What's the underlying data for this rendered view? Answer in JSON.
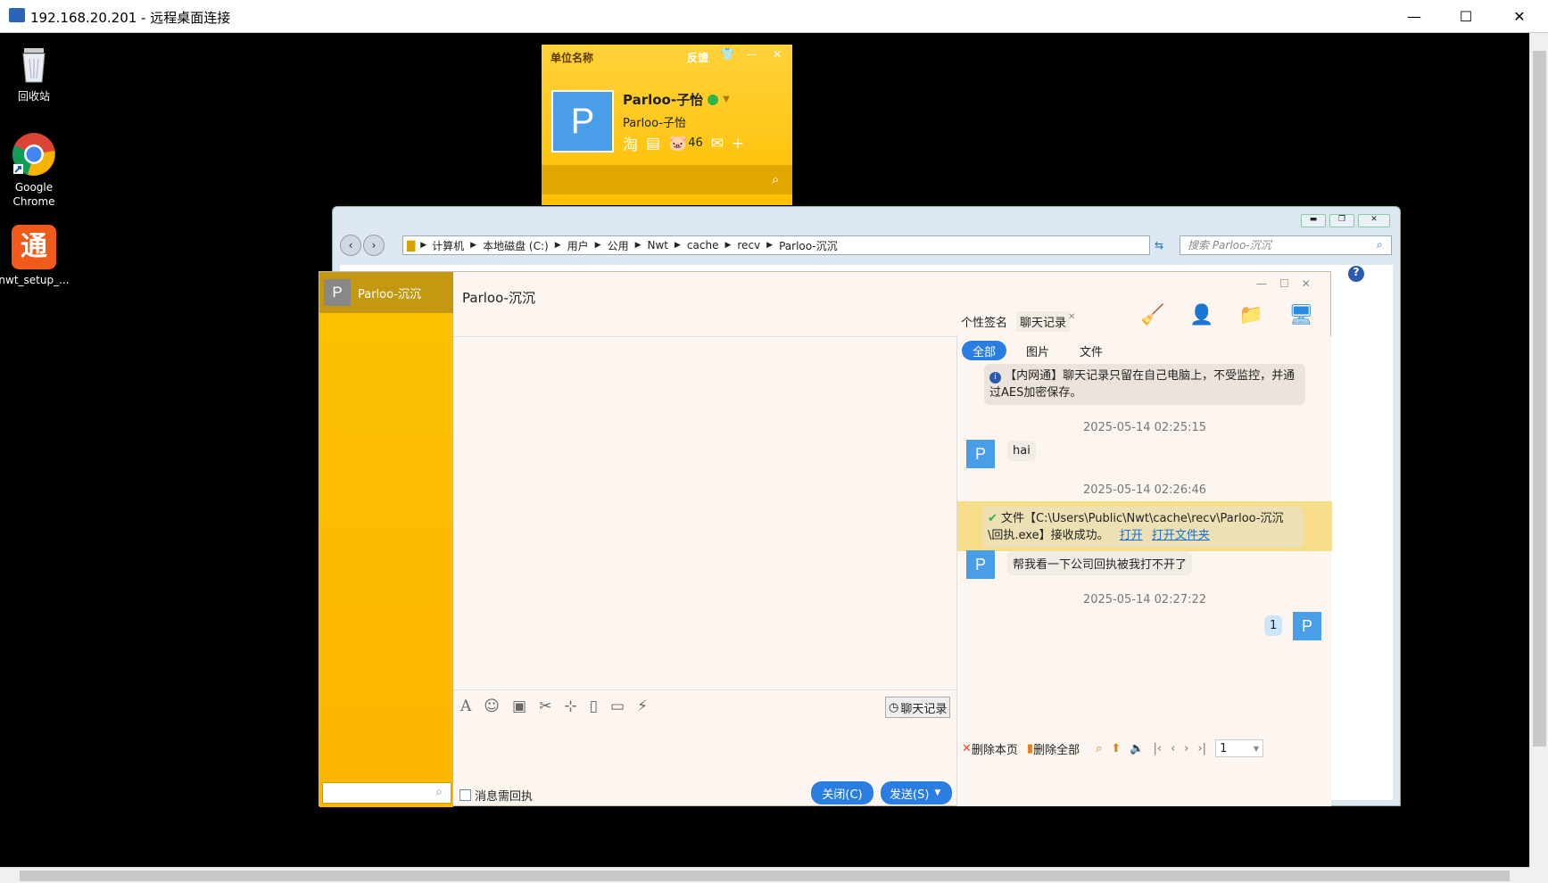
{
  "rdp": {
    "title": "192.168.20.201 - 远程桌面连接",
    "min": "—",
    "max": "☐",
    "close": "✕"
  },
  "desktop": {
    "icons": [
      {
        "label": "回收站"
      },
      {
        "label": "Google Chrome"
      },
      {
        "label": "nwt_setup_..."
      }
    ]
  },
  "mini_panel": {
    "org": "单位名称",
    "feedback": "反馈",
    "user": "Parloo-子怡",
    "sub": "Parloo-子怡",
    "avatar": "P",
    "taobao": "淘",
    "count": "46",
    "plus": "+"
  },
  "explorer": {
    "breadcrumb": [
      "计算机",
      "本地磁盘 (C:)",
      "用户",
      "公用",
      "Nwt",
      "cache",
      "recv",
      "Parloo-沉沉"
    ],
    "search_placeholder": "搜索 Parloo-沉沉"
  },
  "chat": {
    "contact": "Parloo-沉沉",
    "sidebar_avatar": "P",
    "tabs": [
      {
        "label": "个性签名"
      },
      {
        "label": "聊天记录"
      }
    ],
    "filters": [
      "全部",
      "图片",
      "文件"
    ],
    "notice": "【内网通】聊天记录只留在自己电脑上，不受监控，并通过AES加密保存。",
    "messages": [
      {
        "time": "2025-05-14 02:25:15",
        "text": "hai",
        "avatar": "P"
      },
      {
        "time": "2025-05-14 02:26:46",
        "file_text": "文件【C:\\Users\\Public\\Nwt\\cache\\recv\\Parloo-沉沉\\回执.exe】接收成功。",
        "open": "打开",
        "open_folder": "打开文件夹"
      },
      {
        "text": "帮我看一下公司回执被我打不开了",
        "avatar": "P"
      },
      {
        "time": "2025-05-14 02:27:22",
        "text": "1",
        "avatar": "P"
      }
    ],
    "history_button": "聊天记录",
    "receipt_label": "消息需回执",
    "close_button": "关闭(C)",
    "send_button": "发送(S)",
    "delete_page": "删除本页",
    "delete_all": "删除全部",
    "page_number": "1"
  }
}
